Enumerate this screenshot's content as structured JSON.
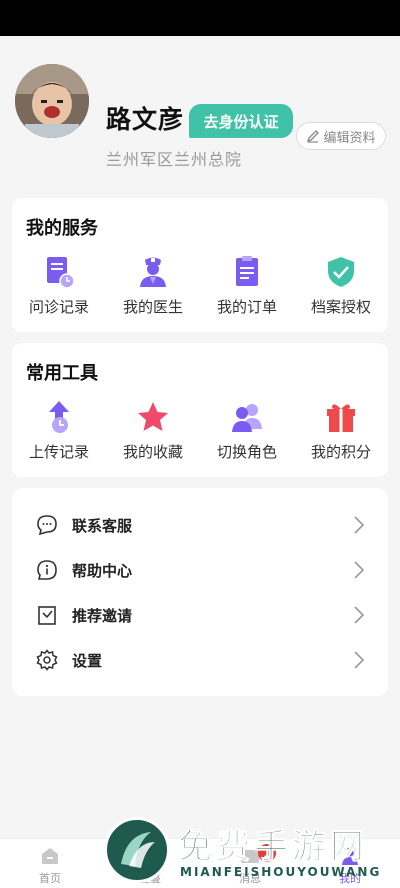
{
  "profile": {
    "name": "路文彦",
    "verify_label": "去身份认证",
    "edit_label": "编辑资料",
    "hospital": "兰州军区兰州总院"
  },
  "services": {
    "title": "我的服务",
    "items": [
      {
        "label": "问诊记录",
        "icon": "consult-record-icon"
      },
      {
        "label": "我的医生",
        "icon": "doctor-icon"
      },
      {
        "label": "我的订单",
        "icon": "order-icon"
      },
      {
        "label": "档案授权",
        "icon": "shield-check-icon"
      }
    ]
  },
  "tools": {
    "title": "常用工具",
    "items": [
      {
        "label": "上传记录",
        "icon": "upload-icon"
      },
      {
        "label": "我的收藏",
        "icon": "star-icon"
      },
      {
        "label": "切换角色",
        "icon": "switch-user-icon"
      },
      {
        "label": "我的积分",
        "icon": "gift-icon"
      }
    ]
  },
  "menu": {
    "items": [
      {
        "label": "联系客服",
        "icon": "chat-icon"
      },
      {
        "label": "帮助中心",
        "icon": "info-icon"
      },
      {
        "label": "推荐邀请",
        "icon": "invite-icon"
      },
      {
        "label": "设置",
        "icon": "gear-icon"
      }
    ]
  },
  "tabbar": {
    "items": [
      {
        "label": "首页"
      },
      {
        "label": "蔓蔓"
      },
      {
        "label": "消息",
        "badge": "1"
      },
      {
        "label": "我的"
      }
    ]
  },
  "watermark": {
    "title": "免费手游网",
    "subtitle": "MIANFEISHOUYOUWANG"
  },
  "colors": {
    "accent": "#7a5cf0",
    "teal": "#3fc2a7",
    "red": "#ef4a4a"
  }
}
